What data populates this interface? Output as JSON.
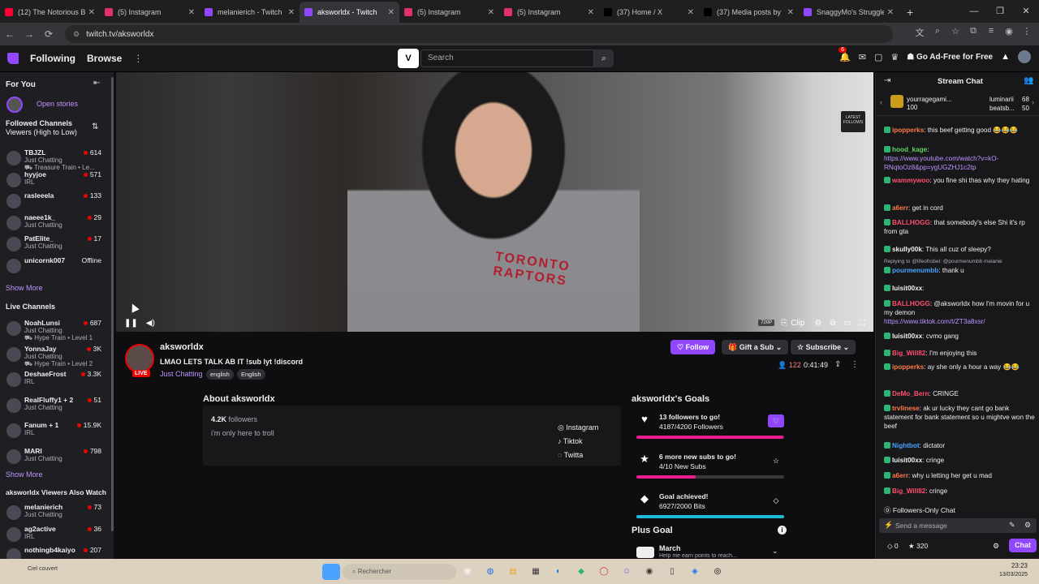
{
  "browser": {
    "tabs": [
      {
        "title": "(12) The Notorious B",
        "color": "#ff0033",
        "active": false
      },
      {
        "title": "(5) Instagram",
        "color": "#e1306c",
        "active": false
      },
      {
        "title": "melanierich - Twitch",
        "color": "#9147ff",
        "active": false
      },
      {
        "title": "aksworldx - Twitch",
        "color": "#9147ff",
        "active": true
      },
      {
        "title": "(5) Instagram",
        "color": "#e1306c",
        "active": false
      },
      {
        "title": "(5) Instagram",
        "color": "#e1306c",
        "active": false
      },
      {
        "title": "(37) Home / X",
        "color": "#000000",
        "active": false
      },
      {
        "title": "(37) Media posts by",
        "color": "#000000",
        "active": false
      },
      {
        "title": "SnaggyMo's Struggle",
        "color": "#9147ff",
        "active": false
      }
    ],
    "url": "twitch.tv/aksworldx"
  },
  "topnav": {
    "following": "Following",
    "browse": "Browse",
    "search_placeholder": "Search",
    "notif_count": "6",
    "adfree": "Go Ad-Free for Free"
  },
  "sidebar": {
    "for_you": "For You",
    "open_stories": "Open stories",
    "followed_title": "Followed Channels",
    "followed_sort": "Viewers (High to Low)",
    "followed": [
      {
        "name": "TBJZL",
        "category": "Just Chatting",
        "extra": "Treasure Train • Le...",
        "viewers": "614",
        "live": true
      },
      {
        "name": "hyyjoe",
        "category": "IRL",
        "extra": "",
        "viewers": "571",
        "live": true
      },
      {
        "name": "rasleeela",
        "category": "",
        "extra": "",
        "viewers": "133",
        "live": true
      },
      {
        "name": "naeee1k_",
        "category": "Just Chatting",
        "extra": "",
        "viewers": "29",
        "live": true
      },
      {
        "name": "PatElite_",
        "category": "Just Chatting",
        "extra": "",
        "viewers": "17",
        "live": true
      },
      {
        "name": "unicornk007",
        "category": "",
        "extra": "",
        "viewers": "Offline",
        "live": false
      }
    ],
    "show_more_1": "Show More",
    "live_title": "Live Channels",
    "live": [
      {
        "name": "NoahLunsi",
        "category": "Just Chatting",
        "extra": "Hype Train • Level 1",
        "viewers": "687"
      },
      {
        "name": "YonnaJay",
        "category": "Just Chatting",
        "extra": "Hype Train • Level 2",
        "viewers": "3K"
      },
      {
        "name": "DeshaeFrost",
        "category": "IRL",
        "extra": "",
        "viewers": "3.3K"
      },
      {
        "name": "RealFluffy1 + 2",
        "category": "Just Chatting",
        "extra": "",
        "viewers": "51"
      },
      {
        "name": "Fanum + 1",
        "category": "IRL",
        "extra": "",
        "viewers": "15.9K"
      },
      {
        "name": "MARI",
        "category": "Just Chatting",
        "extra": "",
        "viewers": "798"
      }
    ],
    "show_more_2": "Show More",
    "also_title": "aksworldx Viewers Also Watch",
    "also": [
      {
        "name": "melanierich",
        "category": "Just Chatting",
        "viewers": "73"
      },
      {
        "name": "ag2active",
        "category": "IRL",
        "viewers": "36"
      },
      {
        "name": "nothingb4kaiyo",
        "category": "",
        "viewers": "207"
      }
    ]
  },
  "video": {
    "quality": "720P",
    "clip": "Clip",
    "shirt_text": "TORONTO RAPTORS",
    "latest_label": "LATEST FOLLOWS"
  },
  "stream": {
    "name": "aksworldx",
    "title": "LMAO LETS TALK AB IT !sub lyt !discord",
    "category": "Just Chatting",
    "tags": [
      "english",
      "English"
    ],
    "live": "LIVE",
    "follow": "Follow",
    "gift": "Gift a Sub",
    "subscribe": "Subscribe",
    "viewers": "122",
    "uptime": "0:41:49"
  },
  "about": {
    "title": "About aksworldx",
    "followers_count": "4.2K",
    "followers_label": "followers",
    "bio": "i'm only here to troll",
    "links": [
      "Instagram",
      "Tiktok",
      "Twitta"
    ]
  },
  "goals": {
    "title": "aksworldx's Goals",
    "items": [
      {
        "title": "13 followers to go!",
        "sub": "4187/4200 Followers",
        "progress": 0.997,
        "color": "#e91e8c"
      },
      {
        "title": "6 more new subs to go!",
        "sub": "4/10 New Subs",
        "progress": 0.4,
        "color": "#e91e8c"
      },
      {
        "title": "Goal achieved!",
        "sub": "6927/2000 Bits",
        "progress": 1.0,
        "color": "#1fb8d6"
      }
    ],
    "plus_goal": "Plus Goal",
    "plus_month": "March",
    "plus_sub": "Help me earn points to reach..."
  },
  "chat": {
    "title": "Stream Chat",
    "leader_1": "yourragegami...",
    "leader_1_val": "100",
    "leader_2": "luminarii",
    "leader_2_val": "68",
    "leader_3": "beatsb...",
    "leader_3_val": "50",
    "messages": [
      {
        "user": "ipopperks",
        "color": "#ff7a45",
        "text": "this beef getting good 😂😂😂"
      },
      {
        "user": "hood_kage",
        "color": "#5fd35f",
        "text": "",
        "link": "https://www.youtube.com/watch?v=kO-RNqtoOz8&pp=ygUGZHJ1c2tp"
      },
      {
        "user": "wammywoo",
        "color": "#ff4f6d",
        "text": "you fine shi thas why they hating"
      },
      {
        "user": "a6err",
        "color": "#ff7a45",
        "text": "get in cord"
      },
      {
        "user": "BALLHOGG",
        "color": "#ff4f6d",
        "text": "that somebody's else Shi it's rp from gta"
      },
      {
        "user": "skully00k",
        "color": "#efeff1",
        "text": "This all cuz of sleepy?"
      },
      {
        "user": "pourmenumbb",
        "color": "#4aa3ff",
        "text": "thank u",
        "reply": "Replying to @lifeofrobel: @pourmenumbb melanie"
      },
      {
        "user": "luisit00xx",
        "color": "#efeff1",
        "text": ""
      },
      {
        "user": "BALLHOGG",
        "color": "#ff4f6d",
        "text": "@aksworldx how I'm movin for u my demon",
        "link": "https://www.tiktok.com/t/ZT3a8xsr/"
      },
      {
        "user": "luisit00xx",
        "color": "#efeff1",
        "text": "cvmo gang"
      },
      {
        "user": "Big_Will82",
        "color": "#ff4f6d",
        "text": "I'm enjoying this"
      },
      {
        "user": "ipopperks",
        "color": "#ff7a45",
        "text": "ay she only a hour a way 😂😂"
      },
      {
        "user": "DeMo_Bern",
        "color": "#ff4f6d",
        "text": "CRINGE"
      },
      {
        "user": "trvlinese",
        "color": "#ff7a45",
        "text": "ak ur lucky they cant go bank statement for bank statement so u mightve won the beef"
      },
      {
        "user": "Nightbot",
        "color": "#4aa3ff",
        "text": "dictator"
      },
      {
        "user": "luisit00xx",
        "color": "#efeff1",
        "text": "cringe"
      },
      {
        "user": "a6err",
        "color": "#ff7a45",
        "text": "why u letting her get u mad"
      },
      {
        "user": "Big_Will82",
        "color": "#ff4f6d",
        "text": "cringe"
      }
    ],
    "followers_only": "Followers-Only Chat",
    "placeholder": "Send a message",
    "points_zero": "0",
    "points": "320",
    "chat_btn": "Chat"
  },
  "taskbar": {
    "weather": "Ciel couvert",
    "search": "Rechercher",
    "time": "23:23",
    "date": "13/03/2025"
  },
  "colors": {
    "accent": "#9147ff",
    "live": "#eb0400",
    "link": "#bf94ff"
  }
}
